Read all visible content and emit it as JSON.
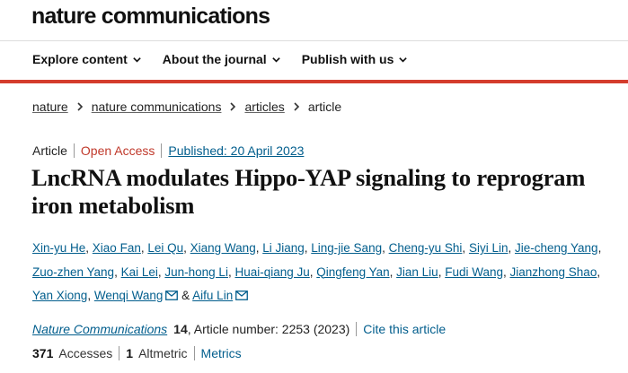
{
  "site": {
    "brand": "nature communications"
  },
  "nav": {
    "items": [
      {
        "label": "Explore content"
      },
      {
        "label": "About the journal"
      },
      {
        "label": "Publish with us"
      }
    ]
  },
  "breadcrumb": {
    "items": [
      "nature",
      "nature communications",
      "articles"
    ],
    "current": "article"
  },
  "article": {
    "type": "Article",
    "access": "Open Access",
    "published": "Published: 20 April 2023",
    "title": "LncRNA modulates Hippo-YAP signaling to reprogram iron metabolism",
    "authors": [
      "Xin-yu He",
      "Xiao Fan",
      "Lei Qu",
      "Xiang Wang",
      "Li Jiang",
      "Ling-jie Sang",
      "Cheng-yu Shi",
      "Siyi Lin",
      "Jie-cheng Yang",
      "Zuo-zhen Yang",
      "Kai Lei",
      "Jun-hong Li",
      "Huai-qiang Ju",
      "Qingfeng Yan",
      "Jian Liu",
      "Fudi Wang",
      "Jianzhong Shao",
      "Yan Xiong",
      "Wenqi Wang",
      "Aifu Lin"
    ],
    "and_text": "&",
    "journal": "Nature Communications",
    "volume": "14",
    "article_number": ", Article number: 2253 (2023)",
    "cite_link": "Cite this article",
    "accesses_count": "371",
    "accesses_label": "Accesses",
    "altmetric_count": "1",
    "altmetric_label": "Altmetric",
    "metrics_link": "Metrics"
  },
  "colors": {
    "accent_red": "#d43c2c",
    "link_blue": "#025e8d",
    "open_access": "#c0392b"
  },
  "icons": {
    "chevron": "chevron-down-icon",
    "mail": "mail-icon",
    "breadcrumb_sep": "chevron-right-icon"
  }
}
